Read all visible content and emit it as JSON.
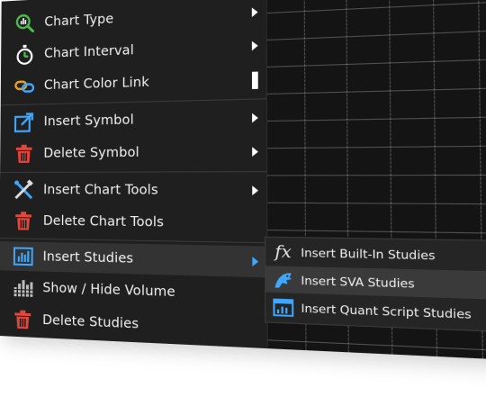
{
  "menu": {
    "items": [
      {
        "label": "Chart Type",
        "icon": "chart-type-icon",
        "has_submenu": true
      },
      {
        "label": "Chart Interval",
        "icon": "stopwatch-icon",
        "has_submenu": true
      },
      {
        "label": "Chart Color Link",
        "icon": "link-icon",
        "has_submenu": false
      },
      {
        "label": "Insert Symbol",
        "icon": "insert-symbol-icon",
        "has_submenu": true
      },
      {
        "label": "Delete Symbol",
        "icon": "trash-icon",
        "has_submenu": true
      },
      {
        "label": "Insert Chart Tools",
        "icon": "tools-icon",
        "has_submenu": true
      },
      {
        "label": "Delete Chart Tools",
        "icon": "trash-icon",
        "has_submenu": false
      },
      {
        "label": "Insert Studies",
        "icon": "studies-icon",
        "has_submenu": true,
        "active": true
      },
      {
        "label": "Show / Hide Volume",
        "icon": "volume-icon",
        "has_submenu": false
      },
      {
        "label": "Delete Studies",
        "icon": "trash-icon",
        "has_submenu": false
      }
    ]
  },
  "submenu": {
    "items": [
      {
        "label": "Insert Built-In Studies",
        "icon": "fx-icon",
        "icon_text": "fx"
      },
      {
        "label": "Insert SVA Studies",
        "icon": "sva-icon",
        "active": true
      },
      {
        "label": "Insert Quant Script Studies",
        "icon": "quant-script-icon"
      }
    ]
  },
  "colors": {
    "menu_bg": "#1f1f1f",
    "active_bg": "#333333",
    "accent_blue": "#3ea8ff",
    "trash_red": "#e0473d",
    "green": "#4bbf4b",
    "orange": "#f0a020"
  }
}
